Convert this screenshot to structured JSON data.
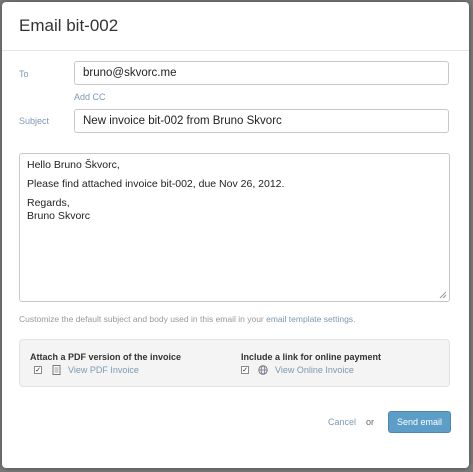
{
  "dialog": {
    "title": "Email bit-002"
  },
  "to": {
    "label": "To",
    "value": "bruno@skvorc.me",
    "add_cc": "Add CC"
  },
  "subject": {
    "label": "Subject",
    "value": "New invoice bit-002 from Bruno Skvorc"
  },
  "body": {
    "lines": [
      "Hello Bruno Škvorc,",
      "",
      "Please find attached invoice bit-002, due Nov 26, 2012.",
      "",
      "Regards,",
      "Bruno Skvorc"
    ]
  },
  "hint": {
    "prefix": "Customize the default subject and body used in this email in your ",
    "link": "email template settings",
    "suffix": "."
  },
  "options": {
    "pdf_title": "Attach a PDF version of the invoice",
    "pdf_checked": true,
    "pdf_icon": "document-icon",
    "pdf_link": "View PDF Invoice",
    "online_title": "Include a link for online payment",
    "online_checked": true,
    "online_icon": "globe-icon",
    "online_link": "View Online Invoice"
  },
  "footer": {
    "cancel_label": "Cancel",
    "or_label": "or",
    "send_label": "Send email"
  },
  "colors": {
    "link": "#7d98b3",
    "send_button": "#5d9ec9"
  }
}
